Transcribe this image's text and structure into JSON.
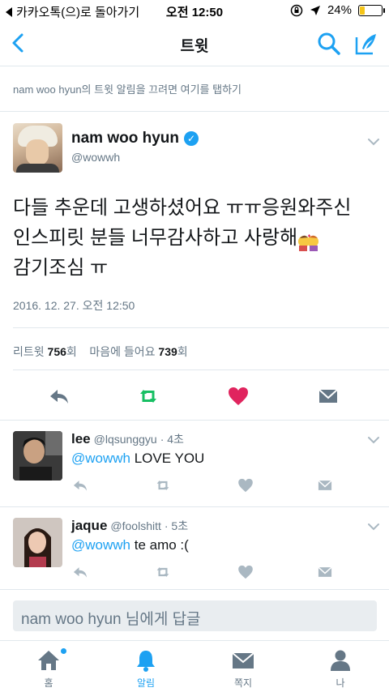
{
  "status_bar": {
    "back_app": "카카오톡(으)로 돌아가기",
    "time": "오전 12:50",
    "battery": "24%",
    "battery_level": 0.24
  },
  "nav": {
    "title": "트윗"
  },
  "notification_tip": "nam woo hyun의 트윗 알림을 끄려면 여기를 탭하기",
  "tweet": {
    "author_name": "nam woo hyun",
    "handle": "@wowwh",
    "text_lines": [
      "다들 추운데 고생하셨어요 ㅠㅠ응원와주신",
      "인스피릿 분들 너무감사하고 사랑해",
      "감기조심 ㅠ"
    ],
    "timestamp": "2016. 12. 27. 오전 12:50",
    "retweets_label": "리트윗",
    "retweets_count": "756",
    "retweets_unit": "회",
    "likes_label": "마음에 들어요",
    "likes_count": "739",
    "likes_unit": "회"
  },
  "replies": [
    {
      "name": "lee",
      "handle": "@lqsunggyu",
      "time": "· 4초",
      "mention": "@wowwh",
      "text": " LOVE YOU"
    },
    {
      "name": "jaque",
      "handle": "@foolshitt",
      "time": "· 5초",
      "mention": "@wowwh",
      "text": " te amo :("
    }
  ],
  "compose": {
    "placeholder": "nam woo hyun 님에게 답글"
  },
  "tabs": [
    {
      "label": "홈",
      "icon": "home-icon"
    },
    {
      "label": "알림",
      "icon": "bell-icon"
    },
    {
      "label": "쪽지",
      "icon": "envelope-icon"
    },
    {
      "label": "나",
      "icon": "person-icon"
    }
  ],
  "colors": {
    "accent": "#1da1f2",
    "retweet": "#17bf63",
    "like": "#e0245e",
    "secondary_text": "#657786"
  }
}
